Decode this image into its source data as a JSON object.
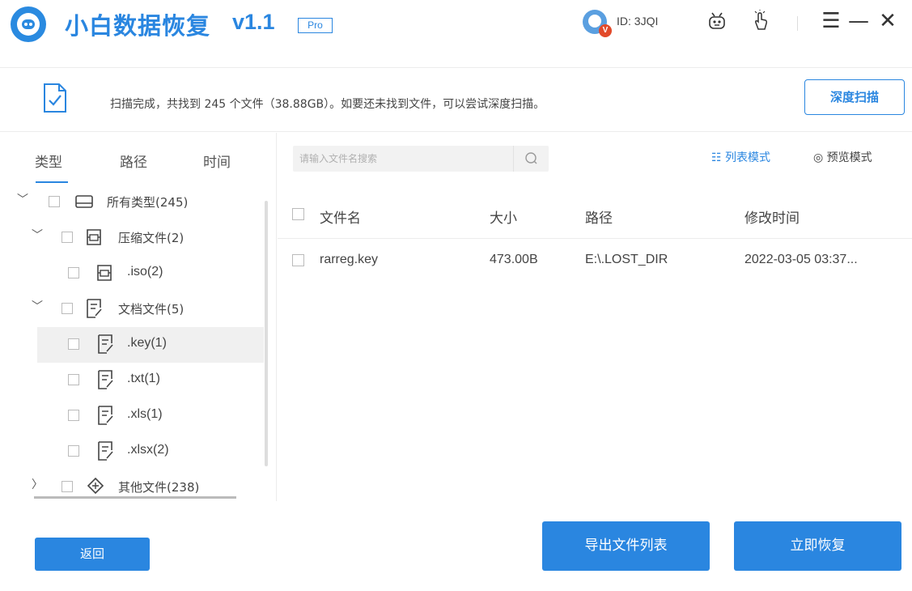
{
  "app": {
    "title": "小白数据恢复",
    "version": "v1.1",
    "badge": "Pro",
    "brand_color": "#2a86e0"
  },
  "header": {
    "user_id": "ID: 3JQI",
    "vip_badge": "V",
    "icons": [
      "avatar-icon",
      "robot-icon",
      "hand-pointer-icon",
      "menu-icon",
      "minimize-icon",
      "close-icon"
    ],
    "menu_glyph": "☰",
    "minimize_glyph": "—",
    "close_glyph": "✕"
  },
  "scan_info": {
    "message": "扫描完成，共找到 245 个文件（38.88GB）。如要还未找到文件，可以尝试深度扫描。",
    "deep_scan_label": "深度扫描"
  },
  "tabs": [
    {
      "label": "类型",
      "active": true
    },
    {
      "label": "路径",
      "active": false
    },
    {
      "label": "时间",
      "active": false
    }
  ],
  "tree": {
    "caret_expanded": "﹀",
    "caret_collapsed": "〉",
    "items": [
      {
        "label": "所有类型(245)",
        "icon": "drive-icon",
        "expanded": true
      },
      {
        "label": "压缩文件(2)",
        "icon": "archive-icon",
        "expanded": true
      },
      {
        "label": ".iso(2)",
        "icon": "archive-icon"
      },
      {
        "label": "文档文件(5)",
        "icon": "document-icon",
        "expanded": true
      },
      {
        "label": ".key(1)",
        "icon": "document-icon",
        "selected": true
      },
      {
        "label": ".txt(1)",
        "icon": "document-icon"
      },
      {
        "label": ".xls(1)",
        "icon": "document-icon"
      },
      {
        "label": ".xlsx(2)",
        "icon": "document-icon"
      },
      {
        "label": "其他文件(238)",
        "icon": "other-file-icon",
        "expanded": false
      }
    ]
  },
  "search": {
    "placeholder": "请输入文件名搜索",
    "value": ""
  },
  "view_modes": {
    "list_label": "☷ 列表模式",
    "preview_label": "◎ 预览模式",
    "active": "list"
  },
  "table": {
    "headers": [
      "文件名",
      "大小",
      "路径",
      "修改时间"
    ],
    "rows": [
      {
        "name": "rarreg.key",
        "size": "473.00B",
        "path": "E:\\.LOST_DIR",
        "modified": "2022-03-05 03:37..."
      }
    ]
  },
  "footer": {
    "back_label": "返回",
    "export_label": "导出文件列表",
    "recover_label": "立即恢复"
  }
}
